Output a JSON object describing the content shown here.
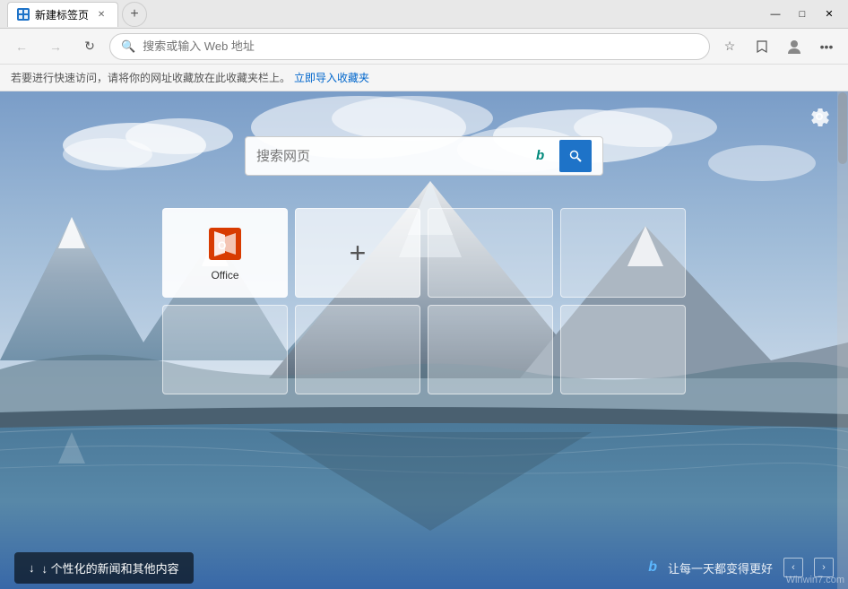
{
  "titleBar": {
    "tab": {
      "label": "新建标签页",
      "favicon": "□"
    },
    "newTabBtn": "+",
    "windowControls": {
      "minimize": "—",
      "maximize": "□",
      "close": "✕"
    }
  },
  "navBar": {
    "backBtn": "←",
    "forwardBtn": "→",
    "refreshBtn": "↻",
    "searchPlaceholder": "搜索或输入 Web 地址",
    "favoritesBtn": "☆",
    "readingListBtn": "☆",
    "profileBtn": "○",
    "settingsBtn": "…"
  },
  "bookmarksBar": {
    "message": "若要进行快速访问，请将你的网址收藏放在此收藏夹栏上。",
    "importLink": "立即导入收藏夹"
  },
  "mainPage": {
    "settingsGear": "⚙",
    "searchPlaceholder": "搜索网页",
    "bingLogo": "b",
    "searchIcon": "🔍",
    "speedDial": {
      "tiles": [
        {
          "type": "office",
          "label": "Office"
        },
        {
          "type": "add",
          "label": "+"
        },
        {
          "type": "empty",
          "label": ""
        },
        {
          "type": "empty",
          "label": ""
        },
        {
          "type": "empty",
          "label": ""
        },
        {
          "type": "empty",
          "label": ""
        },
        {
          "type": "empty",
          "label": ""
        },
        {
          "type": "empty",
          "label": ""
        }
      ]
    },
    "bottomBar": {
      "personalizeBtn": "↓ 个性化的新闻和其他内容",
      "bingText": "b",
      "motto": "让每一天都变得更好",
      "prevBtn": "‹",
      "nextBtn": "›"
    }
  },
  "watermark": "Winwin7.com"
}
